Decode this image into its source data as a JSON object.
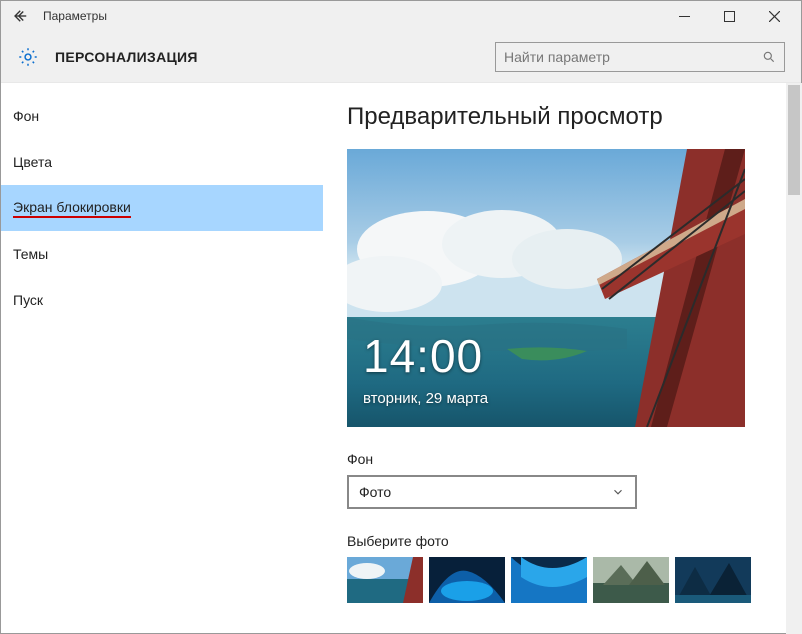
{
  "titlebar": {
    "title": "Параметры"
  },
  "header": {
    "title": "ПЕРСОНАЛИЗАЦИЯ",
    "search_placeholder": "Найти параметр"
  },
  "sidebar": {
    "items": [
      {
        "label": "Фон"
      },
      {
        "label": "Цвета"
      },
      {
        "label": "Экран блокировки"
      },
      {
        "label": "Темы"
      },
      {
        "label": "Пуск"
      }
    ]
  },
  "main": {
    "preview_heading": "Предварительный просмотр",
    "lock_time": "14:00",
    "lock_date": "вторник, 29 марта",
    "bg_label": "Фон",
    "bg_selected": "Фото",
    "choose_label": "Выберите фото"
  }
}
